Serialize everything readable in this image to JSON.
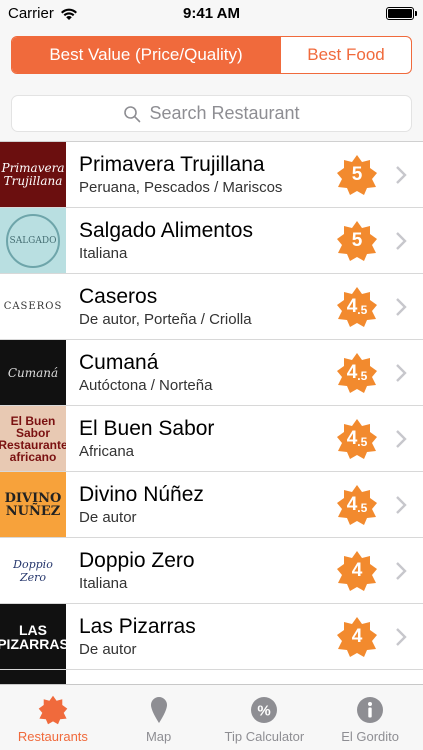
{
  "status_bar": {
    "carrier": "Carrier",
    "time": "9:41 AM"
  },
  "segments": [
    {
      "label": "Best Value (Price/Quality)",
      "active": true
    },
    {
      "label": "Best Food",
      "active": false
    }
  ],
  "search": {
    "placeholder": "Search Restaurant"
  },
  "colors": {
    "accent": "#f06a3c",
    "badge": "#f28a2e"
  },
  "restaurants": [
    {
      "name": "Primavera Trujillana",
      "cuisine": "Peruana, Pescados / Mariscos",
      "rating": "5",
      "rating_sub": "",
      "thumb_text": "Primavera Trujillana"
    },
    {
      "name": "Salgado Alimentos",
      "cuisine": "Italiana",
      "rating": "5",
      "rating_sub": "",
      "thumb_text": "SALGADO"
    },
    {
      "name": "Caseros",
      "cuisine": "De autor, Porteña / Criolla",
      "rating": "4",
      "rating_sub": ".5",
      "thumb_text": "CASEROS"
    },
    {
      "name": "Cumaná",
      "cuisine": "Autóctona / Norteña",
      "rating": "4",
      "rating_sub": ".5",
      "thumb_text": "Cumaná"
    },
    {
      "name": "El Buen Sabor",
      "cuisine": "Africana",
      "rating": "4",
      "rating_sub": ".5",
      "thumb_text": "El Buen Sabor Restaurante africano"
    },
    {
      "name": "Divino Núñez",
      "cuisine": "De autor",
      "rating": "4",
      "rating_sub": ".5",
      "thumb_text": "DIVINO NUÑEZ"
    },
    {
      "name": "Doppio Zero",
      "cuisine": "Italiana",
      "rating": "4",
      "rating_sub": "",
      "thumb_text": "Doppio Zero"
    },
    {
      "name": "Las Pizarras",
      "cuisine": "De autor",
      "rating": "4",
      "rating_sub": "",
      "thumb_text": "LAS PIZARRAS"
    }
  ],
  "tabs": [
    {
      "label": "Restaurants",
      "icon": "badge-icon",
      "active": true
    },
    {
      "label": "Map",
      "icon": "map-pin-icon",
      "active": false
    },
    {
      "label": "Tip Calculator",
      "icon": "percent-icon",
      "active": false
    },
    {
      "label": "El Gordito",
      "icon": "info-icon",
      "active": false
    }
  ]
}
